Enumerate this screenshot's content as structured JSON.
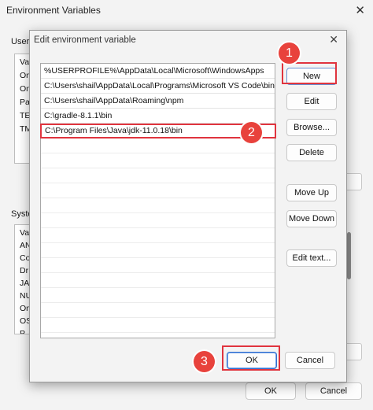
{
  "background_window": {
    "title": "Environment Variables",
    "close_glyph": "✕",
    "user_group_label": "User",
    "user_list_items": [
      "Va",
      "On",
      "On",
      "Pa",
      "TE",
      "TM"
    ],
    "system_group_label": "Syste",
    "system_list_items": [
      "Va",
      "AN",
      "Co",
      "Dr",
      "JA",
      "NU",
      "On",
      "OS",
      "P"
    ],
    "ok_label": "OK",
    "cancel_label": "Cancel"
  },
  "dialog": {
    "title": "Edit environment variable",
    "close_glyph": "✕",
    "paths": [
      "%USERPROFILE%\\AppData\\Local\\Microsoft\\WindowsApps",
      "C:\\Users\\shail\\AppData\\Local\\Programs\\Microsoft VS Code\\bin",
      "C:\\Users\\shail\\AppData\\Roaming\\npm",
      "C:\\gradle-8.1.1\\bin",
      "C:\\Program Files\\Java\\jdk-11.0.18\\bin"
    ],
    "selected_index": 4,
    "buttons": {
      "new": "New",
      "edit": "Edit",
      "browse": "Browse...",
      "delete": "Delete",
      "move_up": "Move Up",
      "move_down": "Move Down",
      "edit_text": "Edit text..."
    },
    "ok_label": "OK",
    "cancel_label": "Cancel"
  },
  "annotations": {
    "badge_1": "1",
    "badge_2": "2",
    "badge_3": "3",
    "color": "#e0343e"
  },
  "colors": {
    "window_bg": "#f3f3f3",
    "list_bg": "#ffffff",
    "highlight_red": "#e0343e",
    "default_button_border": "#2f6fd0"
  }
}
